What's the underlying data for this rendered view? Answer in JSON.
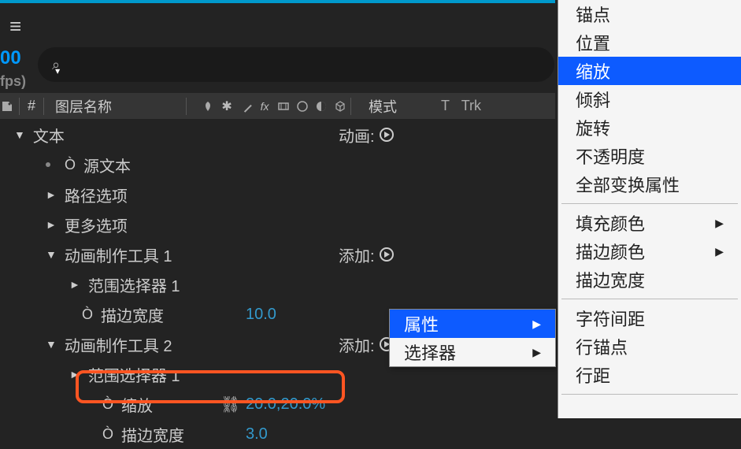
{
  "header": {
    "time": "00",
    "fps": "fps)",
    "col_hash": "#",
    "col_layername": "图层名称",
    "col_mode": "模式",
    "col_t": "T",
    "col_trk": "Trk"
  },
  "layer": {
    "text": "文本",
    "source_text": "源文本",
    "path_options": "路径选项",
    "more_options": "更多选项",
    "anim_btn": "动画:",
    "add_btn": "添加:",
    "animator1": "动画制作工具 1",
    "range_sel1": "范围选择器 1",
    "stroke_width": "描边宽度",
    "stroke_width_val": "10.0",
    "animator2": "动画制作工具 2",
    "range_sel2": "范围选择器 1",
    "scale": "缩放",
    "scale_val": "20.0,20.0%",
    "stroke_width2": "描边宽度",
    "stroke_width2_val": "3.0"
  },
  "ctx": {
    "property": "属性",
    "selector": "选择器"
  },
  "side": {
    "anchor": "锚点",
    "position": "位置",
    "scale": "缩放",
    "skew": "倾斜",
    "rotation": "旋转",
    "opacity": "不透明度",
    "all_transform": "全部变换属性",
    "fill_color": "填充颜色",
    "stroke_color": "描边颜色",
    "stroke_width": "描边宽度",
    "tracking": "字符间距",
    "line_anchor": "行锚点",
    "line_spacing": "行距"
  }
}
